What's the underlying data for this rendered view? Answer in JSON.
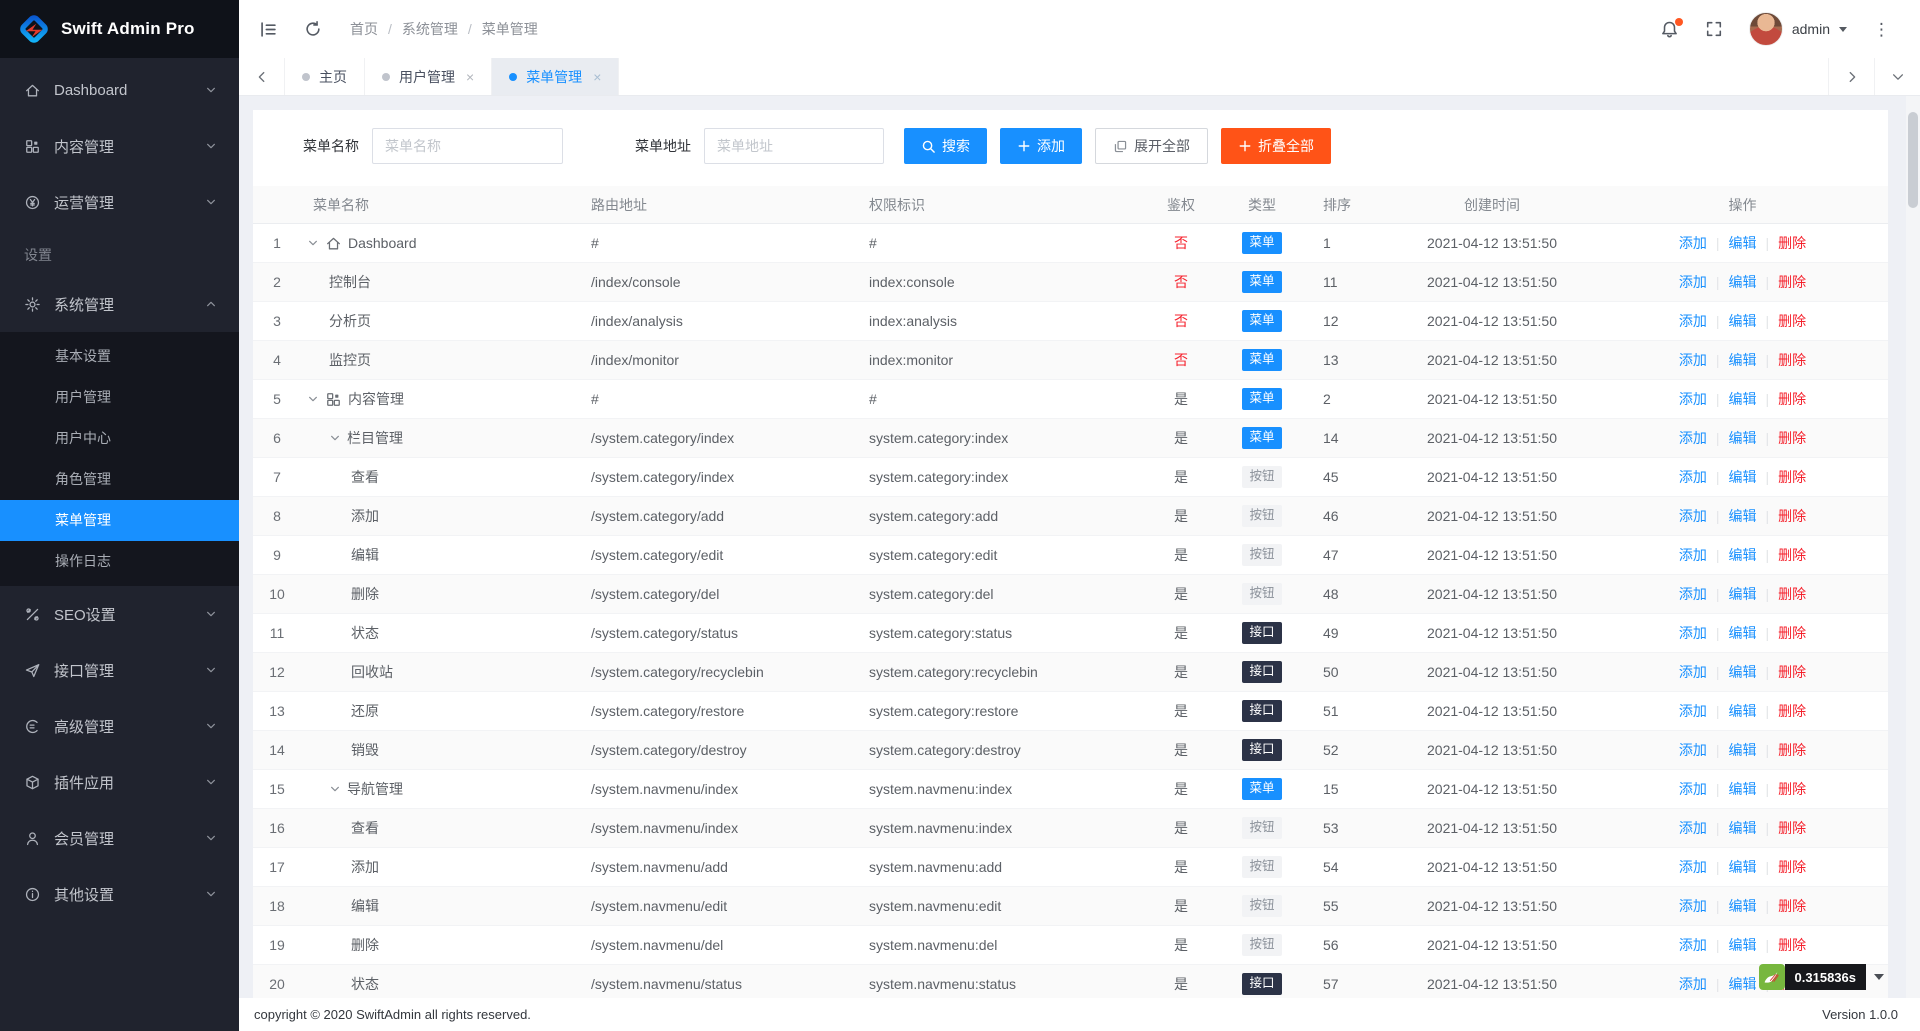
{
  "app": {
    "title": "Swift Admin Pro"
  },
  "sidebar": {
    "logo_text": "Swift Admin Pro",
    "items": [
      {
        "type": "item",
        "key": "dashboard",
        "icon": "home",
        "label": "Dashboard",
        "chevron": "down"
      },
      {
        "type": "item",
        "key": "content",
        "icon": "grid",
        "label": "内容管理",
        "chevron": "down"
      },
      {
        "type": "item",
        "key": "operation",
        "icon": "yen",
        "label": "运营管理",
        "chevron": "down"
      },
      {
        "type": "section",
        "label": "设置"
      },
      {
        "type": "item",
        "key": "system",
        "icon": "gear",
        "label": "系统管理",
        "chevron": "up",
        "children": [
          {
            "label": "基本设置",
            "active": false
          },
          {
            "label": "用户管理",
            "active": false
          },
          {
            "label": "用户中心",
            "active": false
          },
          {
            "label": "角色管理",
            "active": false
          },
          {
            "label": "菜单管理",
            "active": true
          },
          {
            "label": "操作日志",
            "active": false
          }
        ]
      },
      {
        "type": "item",
        "key": "seo",
        "icon": "tools",
        "label": "SEO设置",
        "chevron": "down"
      },
      {
        "type": "item",
        "key": "api",
        "icon": "send",
        "label": "接口管理",
        "chevron": "down"
      },
      {
        "type": "item",
        "key": "advanced",
        "icon": "advanced",
        "label": "高级管理",
        "chevron": "down"
      },
      {
        "type": "item",
        "key": "plugin",
        "icon": "cube",
        "label": "插件应用",
        "chevron": "down"
      },
      {
        "type": "item",
        "key": "member",
        "icon": "member",
        "label": "会员管理",
        "chevron": "down"
      },
      {
        "type": "item",
        "key": "other",
        "icon": "info",
        "label": "其他设置",
        "chevron": "down"
      }
    ]
  },
  "header": {
    "breadcrumb": [
      "首页",
      "系统管理",
      "菜单管理"
    ],
    "username": "admin"
  },
  "tabs": [
    {
      "label": "主页",
      "active": false,
      "closable": false
    },
    {
      "label": "用户管理",
      "active": false,
      "closable": true
    },
    {
      "label": "菜单管理",
      "active": true,
      "closable": true
    }
  ],
  "search": {
    "name_label": "菜单名称",
    "name_placeholder": "菜单名称",
    "url_label": "菜单地址",
    "url_placeholder": "菜单地址",
    "buttons": {
      "search": "搜索",
      "add": "添加",
      "expand_all": "展开全部",
      "collapse_all": "折叠全部"
    }
  },
  "table": {
    "columns": [
      "菜单名称",
      "路由地址",
      "权限标识",
      "鉴权",
      "类型",
      "排序",
      "创建时间",
      "操作"
    ],
    "actions": [
      "添加",
      "编辑",
      "删除"
    ],
    "rows": [
      {
        "id": 1,
        "level": 0,
        "expandable": true,
        "icon": "home",
        "name": "Dashboard",
        "route": "#",
        "perm": "#",
        "auth": "否",
        "type": "菜单",
        "sort": 1,
        "created": "2021-04-12 13:51:50"
      },
      {
        "id": 2,
        "level": 1,
        "expandable": false,
        "name": "控制台",
        "route": "/index/console",
        "perm": "index:console",
        "auth": "否",
        "type": "菜单",
        "sort": 11,
        "created": "2021-04-12 13:51:50"
      },
      {
        "id": 3,
        "level": 1,
        "expandable": false,
        "name": "分析页",
        "route": "/index/analysis",
        "perm": "index:analysis",
        "auth": "否",
        "type": "菜单",
        "sort": 12,
        "created": "2021-04-12 13:51:50"
      },
      {
        "id": 4,
        "level": 1,
        "expandable": false,
        "name": "监控页",
        "route": "/index/monitor",
        "perm": "index:monitor",
        "auth": "否",
        "type": "菜单",
        "sort": 13,
        "created": "2021-04-12 13:51:50"
      },
      {
        "id": 5,
        "level": 0,
        "expandable": true,
        "icon": "grid",
        "name": "内容管理",
        "route": "#",
        "perm": "#",
        "auth": "是",
        "type": "菜单",
        "sort": 2,
        "created": "2021-04-12 13:51:50"
      },
      {
        "id": 6,
        "level": 1,
        "expandable": true,
        "name": "栏目管理",
        "route": "/system.category/index",
        "perm": "system.category:index",
        "auth": "是",
        "type": "菜单",
        "sort": 14,
        "created": "2021-04-12 13:51:50"
      },
      {
        "id": 7,
        "level": 2,
        "expandable": false,
        "name": "查看",
        "route": "/system.category/index",
        "perm": "system.category:index",
        "auth": "是",
        "type": "按钮",
        "sort": 45,
        "created": "2021-04-12 13:51:50"
      },
      {
        "id": 8,
        "level": 2,
        "expandable": false,
        "name": "添加",
        "route": "/system.category/add",
        "perm": "system.category:add",
        "auth": "是",
        "type": "按钮",
        "sort": 46,
        "created": "2021-04-12 13:51:50"
      },
      {
        "id": 9,
        "level": 2,
        "expandable": false,
        "name": "编辑",
        "route": "/system.category/edit",
        "perm": "system.category:edit",
        "auth": "是",
        "type": "按钮",
        "sort": 47,
        "created": "2021-04-12 13:51:50"
      },
      {
        "id": 10,
        "level": 2,
        "expandable": false,
        "name": "删除",
        "route": "/system.category/del",
        "perm": "system.category:del",
        "auth": "是",
        "type": "按钮",
        "sort": 48,
        "created": "2021-04-12 13:51:50"
      },
      {
        "id": 11,
        "level": 2,
        "expandable": false,
        "name": "状态",
        "route": "/system.category/status",
        "perm": "system.category:status",
        "auth": "是",
        "type": "接口",
        "sort": 49,
        "created": "2021-04-12 13:51:50"
      },
      {
        "id": 12,
        "level": 2,
        "expandable": false,
        "name": "回收站",
        "route": "/system.category/recyclebin",
        "perm": "system.category:recyclebin",
        "auth": "是",
        "type": "接口",
        "sort": 50,
        "created": "2021-04-12 13:51:50"
      },
      {
        "id": 13,
        "level": 2,
        "expandable": false,
        "name": "还原",
        "route": "/system.category/restore",
        "perm": "system.category:restore",
        "auth": "是",
        "type": "接口",
        "sort": 51,
        "created": "2021-04-12 13:51:50"
      },
      {
        "id": 14,
        "level": 2,
        "expandable": false,
        "name": "销毁",
        "route": "/system.category/destroy",
        "perm": "system.category:destroy",
        "auth": "是",
        "type": "接口",
        "sort": 52,
        "created": "2021-04-12 13:51:50"
      },
      {
        "id": 15,
        "level": 1,
        "expandable": true,
        "name": "导航管理",
        "route": "/system.navmenu/index",
        "perm": "system.navmenu:index",
        "auth": "是",
        "type": "菜单",
        "sort": 15,
        "created": "2021-04-12 13:51:50"
      },
      {
        "id": 16,
        "level": 2,
        "expandable": false,
        "name": "查看",
        "route": "/system.navmenu/index",
        "perm": "system.navmenu:index",
        "auth": "是",
        "type": "按钮",
        "sort": 53,
        "created": "2021-04-12 13:51:50"
      },
      {
        "id": 17,
        "level": 2,
        "expandable": false,
        "name": "添加",
        "route": "/system.navmenu/add",
        "perm": "system.navmenu:add",
        "auth": "是",
        "type": "按钮",
        "sort": 54,
        "created": "2021-04-12 13:51:50"
      },
      {
        "id": 18,
        "level": 2,
        "expandable": false,
        "name": "编辑",
        "route": "/system.navmenu/edit",
        "perm": "system.navmenu:edit",
        "auth": "是",
        "type": "按钮",
        "sort": 55,
        "created": "2021-04-12 13:51:50"
      },
      {
        "id": 19,
        "level": 2,
        "expandable": false,
        "name": "删除",
        "route": "/system.navmenu/del",
        "perm": "system.navmenu:del",
        "auth": "是",
        "type": "按钮",
        "sort": 56,
        "created": "2021-04-12 13:51:50"
      },
      {
        "id": 20,
        "level": 2,
        "expandable": false,
        "name": "状态",
        "route": "/system.navmenu/status",
        "perm": "system.navmenu:status",
        "auth": "是",
        "type": "接口",
        "sort": 57,
        "created": "2021-04-12 13:51:50"
      }
    ]
  },
  "footer": {
    "copyright": "copyright © 2020 SwiftAdmin all rights reserved.",
    "version": "Version 1.0.0",
    "trace_time": "0.315836s"
  },
  "colors": {
    "primary": "#1890ff",
    "orange": "#ff5317",
    "danger": "#f5222d",
    "badge_menu": "#1890ff",
    "badge_button_bg": "#f2f3f5",
    "badge_api_bg": "#2c3347",
    "sidebar_bg": "#20232e",
    "active_menu_bg": "#1890ff"
  }
}
